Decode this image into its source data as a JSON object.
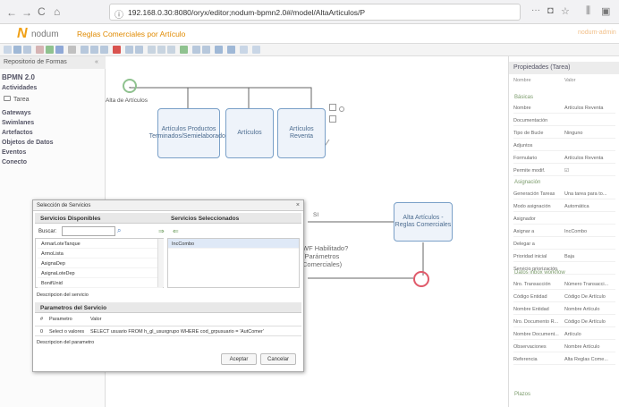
{
  "browser": {
    "url": "192.168.0.30:8080/oryx/editor;nodum-bpmn2.0#/model/AltaArticulos/P",
    "menu_dots": "···"
  },
  "app": {
    "logo_letter": "N",
    "logo_text": "nodum",
    "page_title": "Reglas Comerciales por Artículo",
    "user": "nodum-admin"
  },
  "left_panel": {
    "title": "Repositorio de Formas",
    "sections": [
      "BPMN 2.0",
      "Actividades",
      "Tarea",
      "Gateways",
      "Swimlanes",
      "Artefactos",
      "Objetos de Datos",
      "Eventos",
      "Conecto"
    ]
  },
  "canvas": {
    "start_label": "Alta de Artículos",
    "task1": "Artículos Productos Terminados/Semielaborados",
    "task2": "Artículos",
    "task3": "Artículos Reventa",
    "task4": "Alta Artículos - Reglas Comerciales",
    "gateway_label": "WF Habilitado? (Parámetros Comerciales)",
    "flow_label": "SI"
  },
  "dialog": {
    "title": "Selección de Servicios",
    "close": "×",
    "available_header": "Servicios Disponibles",
    "selected_header": "Servicios Seleccionados",
    "search_label": "Buscar:",
    "search_value": "",
    "available": [
      "ArmarLoteTanque",
      "ArmoLista",
      "AsignaDep",
      "AsignaLoteDep",
      "BonifUnid"
    ],
    "selected": [
      "IncCombo"
    ],
    "service_desc": "Descripcion del servicio",
    "params_header": "Parametros del Servicio",
    "col_num": "#",
    "col_param": "Parametro",
    "col_value": "Valor",
    "param_row": {
      "num": "0",
      "param": "Select o valores",
      "value": "SELECT usuario FROM h_gl_usuxgrupo WHERE cod_grpusuario = 'AutComer'"
    },
    "param_desc": "Descripcion del parametro",
    "accept": "Aceptar",
    "cancel": "Cancelar"
  },
  "right_panel": {
    "title": "Propiedades (Tarea)",
    "col_name": "Nombre",
    "col_value": "Valor",
    "sec_basic": "Básicas",
    "basic": [
      {
        "k": "Nombre",
        "v": "Artículos Reventa"
      },
      {
        "k": "Documentación",
        "v": ""
      },
      {
        "k": "Tipo de Bucle",
        "v": "Ninguno"
      },
      {
        "k": "Adjuntos",
        "v": ""
      },
      {
        "k": "Formulario",
        "v": "Artículos Reventa"
      },
      {
        "k": "Permite modif.",
        "v": "☑"
      }
    ],
    "sec_assign": "Asignación",
    "assign": [
      {
        "k": "Generación Tareas",
        "v": "Una tarea para to..."
      },
      {
        "k": "Modo asignación",
        "v": "Automática"
      },
      {
        "k": "Asignador",
        "v": ""
      },
      {
        "k": "Asignar a",
        "v": "IncCombo"
      },
      {
        "k": "Delegar a",
        "v": ""
      },
      {
        "k": "Prioridad inicial",
        "v": "Baja"
      },
      {
        "k": "Servicio priorización",
        "v": ""
      }
    ],
    "sec_inbox": "Datos inbox workflow",
    "inbox": [
      {
        "k": "Nro. Transacción",
        "v": "Número Transacci..."
      },
      {
        "k": "Código Entidad",
        "v": "Código De Artículo"
      },
      {
        "k": "Nombre Entidad",
        "v": "Nombre Artículo"
      },
      {
        "k": "Nro. Documento R...",
        "v": "Código De Artículo"
      },
      {
        "k": "Nombre Document...",
        "v": "Artículo"
      },
      {
        "k": "Observaciones",
        "v": "Nombre Artículo"
      },
      {
        "k": "Referencia",
        "v": "Alta Reglas Come..."
      }
    ],
    "sec_plazos": "Plazos"
  }
}
